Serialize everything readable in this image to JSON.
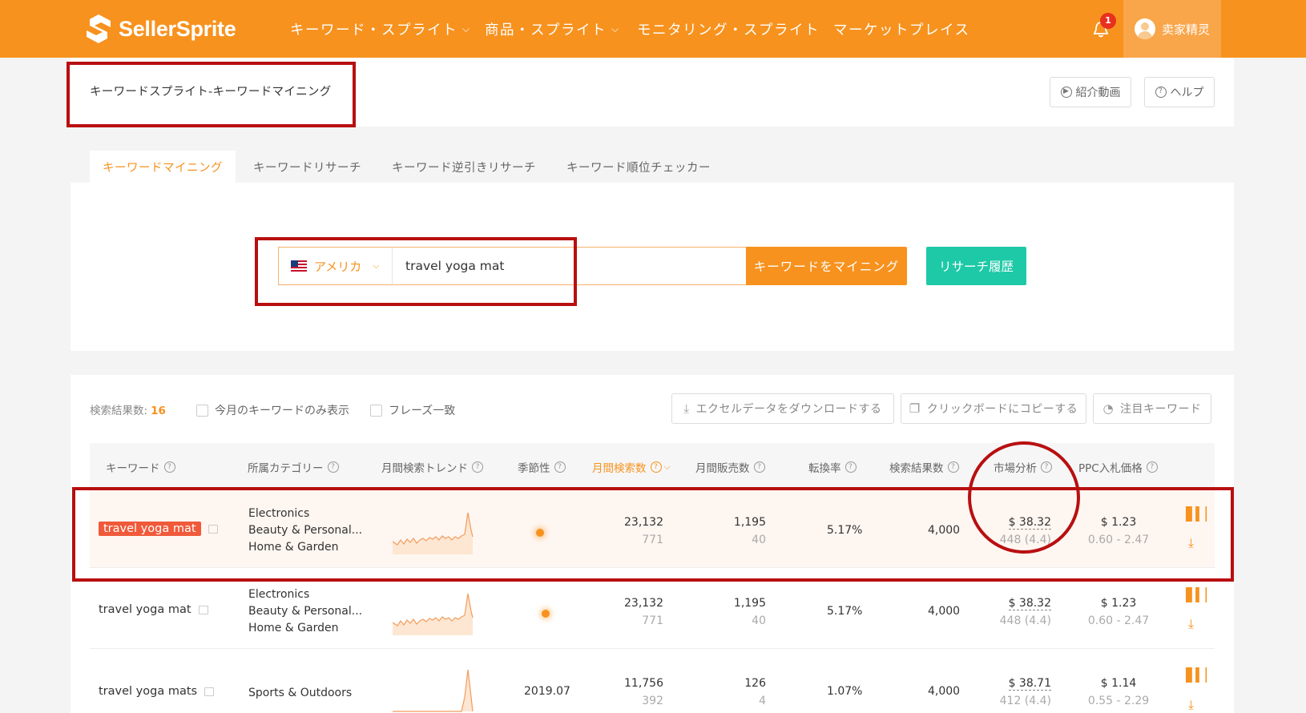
{
  "brand": {
    "name": "SellerSprite",
    "accent": "#f7921e",
    "teal": "#1ec9a7"
  },
  "nav": {
    "items": [
      {
        "label": "キーワード・スプライト",
        "dropdown": true
      },
      {
        "label": "商品・スプライト",
        "dropdown": true
      },
      {
        "label": "モニタリング・スプライト",
        "dropdown": false
      },
      {
        "label": "マーケットプレイス",
        "dropdown": false
      }
    ],
    "notifications": "1",
    "user": "卖家精灵"
  },
  "header": {
    "title": "キーワードスプライト-キーワードマイニング",
    "intro_video": "紹介動画",
    "help": "ヘルプ"
  },
  "tabs": [
    {
      "label": "キーワードマイニング",
      "active": true
    },
    {
      "label": "キーワードリサーチ",
      "active": false
    },
    {
      "label": "キーワード逆引きリサーチ",
      "active": false
    },
    {
      "label": "キーワード順位チェッカー",
      "active": false
    }
  ],
  "search": {
    "country": "アメリカ",
    "query": "travel yoga mat",
    "mine_button": "キーワードをマイニング",
    "history_button": "リサーチ履歴"
  },
  "results": {
    "count_label": "検索結果数:",
    "count": "16",
    "filter_month": "今月のキーワードのみ表示",
    "filter_phrase": "フレーズ一致",
    "export": "エクセルデータをダウンロードする",
    "copy": "クリックボードにコピーする",
    "watch": "注目キーワード"
  },
  "table": {
    "headers": [
      "キーワード",
      "所属カテゴリー",
      "月間検索トレンド",
      "季節性",
      "月間検索数",
      "月間販売数",
      "転換率",
      "検索結果数",
      "市場分析",
      "PPC入札価格"
    ],
    "rows": [
      {
        "keyword": "travel yoga mat",
        "categories": [
          "Electronics",
          "Beauty & Personal...",
          "Home & Garden"
        ],
        "seasonality": "",
        "searches": "23,132",
        "searches_sub": "771",
        "sales": "1,195",
        "sales_sub": "40",
        "conversion": "5.17%",
        "results": "4,000",
        "price": "$ 38.32",
        "reviews": "448 (4.4)",
        "ppc": "$ 1.23",
        "ppc_range": "0.60 - 2.47"
      },
      {
        "keyword": "travel yoga mat",
        "categories": [
          "Electronics",
          "Beauty & Personal...",
          "Home & Garden"
        ],
        "seasonality": "",
        "searches": "23,132",
        "searches_sub": "771",
        "sales": "1,195",
        "sales_sub": "40",
        "conversion": "5.17%",
        "results": "4,000",
        "price": "$ 38.32",
        "reviews": "448 (4.4)",
        "ppc": "$ 1.23",
        "ppc_range": "0.60 - 2.47"
      },
      {
        "keyword": "travel yoga mats",
        "categories": [
          "Sports & Outdoors"
        ],
        "seasonality": "2019.07",
        "searches": "11,756",
        "searches_sub": "392",
        "sales": "126",
        "sales_sub": "4",
        "conversion": "1.07%",
        "results": "4,000",
        "price": "$ 38.71",
        "reviews": "412 (4.4)",
        "ppc": "$ 1.14",
        "ppc_range": "0.55 - 2.29"
      }
    ]
  }
}
